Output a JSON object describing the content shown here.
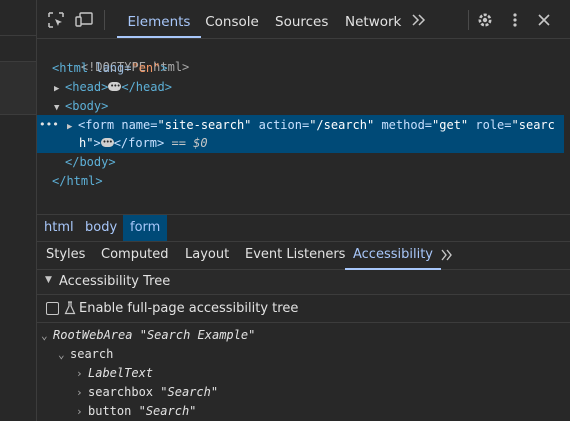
{
  "toolbar": {
    "tabs": [
      {
        "label": "Elements",
        "active": true
      },
      {
        "label": "Console",
        "active": false
      },
      {
        "label": "Sources",
        "active": false
      },
      {
        "label": "Network",
        "active": false
      }
    ],
    "more_tabs_icon": "chevrons-right-icon",
    "settings_icon": "gear-icon",
    "menu_icon": "kebab-menu-icon",
    "close_icon": "close-icon",
    "inspect_icon": "inspect-element-icon",
    "device_icon": "device-toolbar-icon"
  },
  "dom": {
    "doctype": "<!DOCTYPE html>",
    "html_open_tag": "<html",
    "html_lang_attr": " lang=",
    "html_lang_val": "\"en\"",
    "html_open_close": ">",
    "head_open": "<head>",
    "head_close": "</head>",
    "body_open": "<body>",
    "form_open": "<form",
    "form_name_attr": " name=",
    "form_name_val": "\"site-search\"",
    "form_action_attr": " action=",
    "form_action_val": "\"/search\"",
    "form_method_attr": " method=",
    "form_method_val": "\"get\"",
    "form_role_attr": " role=",
    "form_role_val_a": "\"searc",
    "form_role_val_b": "h\"",
    "form_gt": ">",
    "form_close": "</form>",
    "selected_marker": " == $0",
    "body_close": "</body>",
    "html_close": "</html>",
    "row_dots": "•••"
  },
  "breadcrumb": [
    {
      "label": "html",
      "active": false
    },
    {
      "label": "body",
      "active": false
    },
    {
      "label": "form",
      "active": true
    }
  ],
  "subtabs": [
    {
      "label": "Styles",
      "active": false
    },
    {
      "label": "Computed",
      "active": false
    },
    {
      "label": "Layout",
      "active": false
    },
    {
      "label": "Event Listeners",
      "active": false
    },
    {
      "label": "Accessibility",
      "active": true
    }
  ],
  "accessibility": {
    "section_title": "Accessibility Tree",
    "enable_label": "Enable full-page accessibility tree",
    "enable_checked": false,
    "tree": {
      "root_role": "RootWebArea",
      "root_name": "\"Search Example\"",
      "search_role": "search",
      "label_role": "LabelText",
      "searchbox_role": "searchbox",
      "searchbox_name": "\"Search\"",
      "button_role": "button",
      "button_name": "\"Search\""
    }
  },
  "colors": {
    "accent": "#a8c7fa",
    "selection": "#004a77",
    "background": "#282828"
  }
}
